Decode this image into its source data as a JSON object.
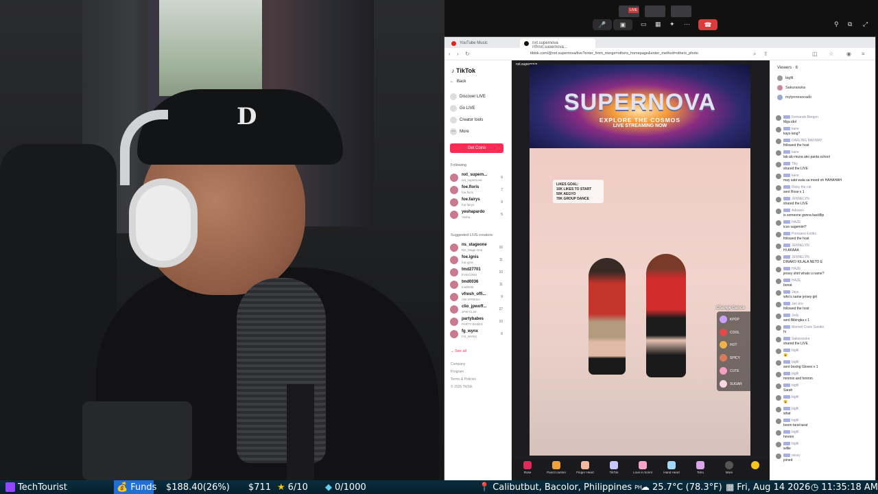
{
  "overlay": {
    "channel": "TechTourist",
    "funds_label": "Funds",
    "funds_amount": "$188.40(26%)",
    "goal_amount": "$711",
    "stars": "6/10",
    "gems": "0/1000",
    "location": "Calibutbut, Bacolor, Philippines",
    "country_code": "PH",
    "weather": "25.7°C (78.3°F)",
    "date": "Fri, Aug 14 2026",
    "time": "11:35:18 AM"
  },
  "topbar": {
    "live_badge": "LIVE",
    "more": "···"
  },
  "browser": {
    "tabs": [
      {
        "label": "YouTube Music"
      },
      {
        "label": "nxt.supernova (@nxt.supernova..."
      }
    ],
    "url": "tiktok.com/@nxt.supernova/live?enter_from_merge=others_homepage&enter_method=others_photo"
  },
  "tiktok": {
    "logo": "TikTok",
    "back": "Back",
    "nav": [
      "Discover LIVE",
      "Go LIVE",
      "Creator tools",
      "More"
    ],
    "get_coins": "Get Coins",
    "following_title": "Following",
    "following": [
      {
        "name": "nxt_supern...",
        "sub": "nxt_supernova",
        "count": "6"
      },
      {
        "name": "foe.floris",
        "sub": "foe.floris",
        "count": "7"
      },
      {
        "name": "foe.fairys",
        "sub": "foe.fairys",
        "count": "9"
      },
      {
        "name": "yeshapardo",
        "sub": "Yesha",
        "count": "5"
      }
    ],
    "suggested_title": "Suggested LIVE creators",
    "suggested": [
      {
        "name": "ns_stageone",
        "sub": "NS_Stage One",
        "count": "16"
      },
      {
        "name": "foe.ignis",
        "sub": "foe.ignis",
        "count": "11"
      },
      {
        "name": "tmd27701",
        "sub": "EYECONS",
        "count": "10"
      },
      {
        "name": "tmd0036",
        "sub": "tmd0036",
        "count": "11"
      },
      {
        "name": "vfresh_offi...",
        "sub": "AW VFRESH",
        "count": "9"
      },
      {
        "name": "clio_jpwoff...",
        "sub": "JPW-CLIO",
        "count": "27"
      },
      {
        "name": "partybabes",
        "sub": "PARTY BABES",
        "count": "10"
      },
      {
        "name": "fg_wynx",
        "sub": "FG_WYNX",
        "count": "6"
      }
    ],
    "see_all": "See all",
    "footer": [
      "Company",
      "Program",
      "Terms & Policies",
      "© 2026 TikTok"
    ]
  },
  "stream": {
    "host": "nxt.supernova",
    "banner_title": "SUPERNOVA",
    "banner_sub": "EXPLORE THE COSMOS",
    "banner_live": "LIVE STREAMING NOW",
    "goal_lines": [
      "LIKES GOAL:",
      "10K LIKES TO START",
      "50K AEGYO",
      "70K GROUP DANCE"
    ],
    "change_dance": "Change Dance",
    "dance_options": [
      "KPOP",
      "COOL",
      "HOT",
      "SPICY",
      "CUTE",
      "SUGAR"
    ],
    "gifts": [
      "Rose",
      "Pancit canton",
      "Finger Heart",
      "TikTok",
      "Love in Scent",
      "Hand Heart",
      "Taho",
      "More"
    ]
  },
  "chat": {
    "viewers_title": "Viewers",
    "viewers_count": "6",
    "viewers": [
      "bigfil",
      "Sakurasuka",
      "mylynnesocado"
    ],
    "messages": [
      {
        "user": "Fernando Bergon",
        "text": "Mga idol"
      },
      {
        "user": "kane",
        "text": "kayo lang?"
      },
      {
        "user": "DARLING MAYMAY",
        "text": "followed the host"
      },
      {
        "user": "kane",
        "text": "lab alo muna ako panta school"
      },
      {
        "user": "Tiky",
        "text": "shared the LIVE"
      },
      {
        "user": "kane",
        "text": "may sabi wala sa mood oh HAHAHAH"
      },
      {
        "user": "Ricky the cat",
        "text": "sent Rose x 1"
      },
      {
        "user": "JENNELYN",
        "text": "shared the LIVE"
      },
      {
        "user": "Adiaseo",
        "text": "is someone gonna backflip"
      },
      {
        "user": "HAZE",
        "text": "icon sagemint?"
      },
      {
        "user": "Ponciano Entitio",
        "text": "followed the host"
      },
      {
        "user": "JENNELYN",
        "text": "HI AKAAA"
      },
      {
        "user": "JENNELYN",
        "text": "DINAKO KILALA NETO E"
      },
      {
        "user": "HAZE",
        "text": "jersey shirt whats u name?"
      },
      {
        "user": "HAZE",
        "text": "bonat"
      },
      {
        "user": "Jays",
        "text": "who's name jersey girl"
      },
      {
        "user": "Jan pro",
        "text": "followed the host"
      },
      {
        "user": "Jody",
        "text": "sent Bibingka x 1"
      },
      {
        "user": "Marivel Cosio Sandio",
        "text": "hi"
      },
      {
        "user": "Sakurasuka",
        "text": "shared the LIVE"
      },
      {
        "user": "bigfil",
        "text": "😮"
      },
      {
        "user": "bigfil",
        "text": "sent boxing Gloves x 1"
      },
      {
        "user": "bigfil",
        "text": "mmmin and hmmm"
      },
      {
        "user": "bigfil",
        "text": "Sarah"
      },
      {
        "user": "bigfil",
        "text": "😮"
      },
      {
        "user": "bigfil",
        "text": "what"
      },
      {
        "user": "bigfil",
        "text": "boom tarat tarat"
      },
      {
        "user": "bigfil",
        "text": "hmmm"
      },
      {
        "user": "bigfil",
        "text": "willie"
      },
      {
        "user": "missy",
        "text": "joined"
      }
    ]
  },
  "colors": {
    "tiktok_red": "#fe2c55",
    "overlay_bg": "#0b2d3f",
    "funds_blue": "#1f6fd6",
    "twitch_purple": "#9146ff"
  }
}
